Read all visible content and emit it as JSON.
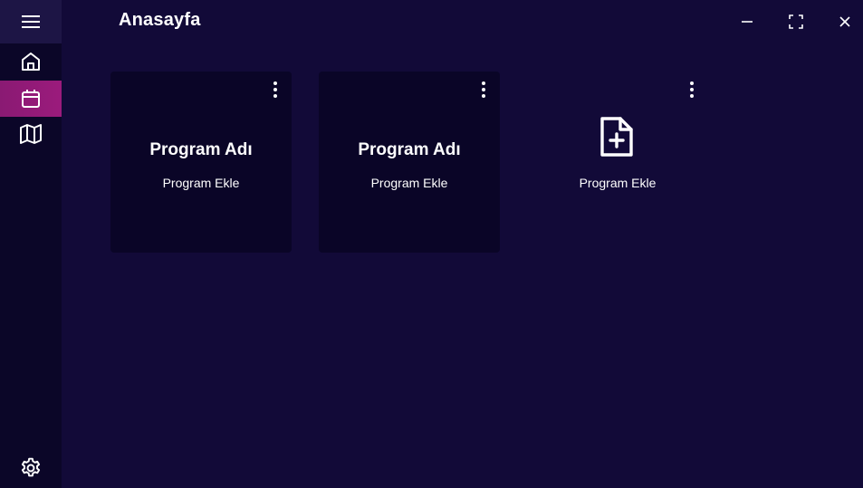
{
  "window": {
    "title": "Anasayfa",
    "controls": [
      "minimize",
      "maximize",
      "close"
    ]
  },
  "sidebar": {
    "items": [
      {
        "name": "home",
        "icon": "home-icon",
        "active": false
      },
      {
        "name": "calendar",
        "icon": "calendar-icon",
        "active": true
      },
      {
        "name": "map",
        "icon": "map-icon",
        "active": false
      }
    ],
    "settings_icon": "gear-icon"
  },
  "cards": [
    {
      "title": "Program Adı",
      "subtitle": "Program Ekle"
    },
    {
      "title": "Program Adı",
      "subtitle": "Program Ekle"
    }
  ],
  "add_card": {
    "label": "Program Ekle",
    "icon": "file-plus-icon"
  },
  "colors": {
    "background": "#120a38",
    "sidebar": "#0b0628",
    "card": "#0a0527",
    "accent": "#9b1b7c"
  }
}
